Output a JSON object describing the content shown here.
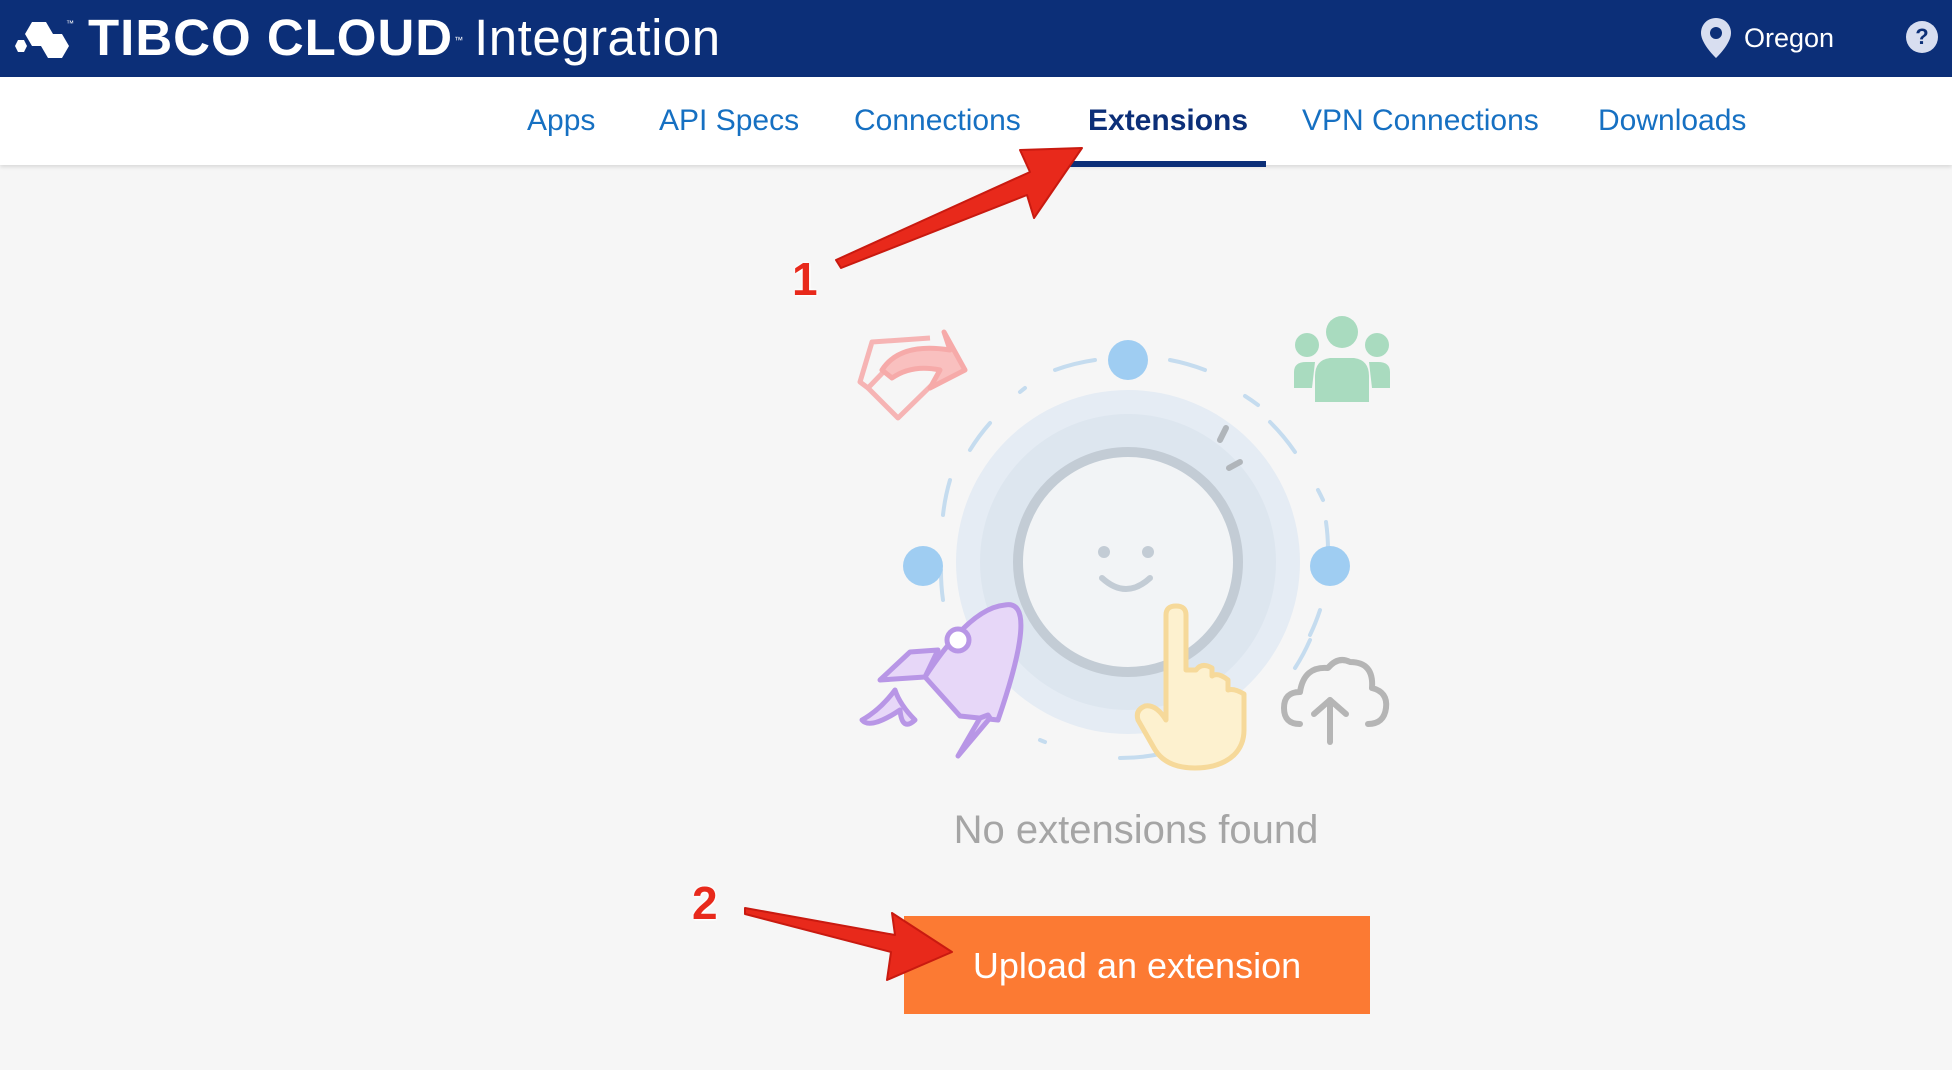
{
  "header": {
    "brand_name": "TIBCO CLOUD",
    "trademark": "™",
    "product": "Integration",
    "region_icon": "location-pin-icon",
    "region": "Oregon",
    "help_icon": "question-circle-icon",
    "help_glyph": "?"
  },
  "nav": {
    "tabs": [
      {
        "label": "Apps"
      },
      {
        "label": "API Specs"
      },
      {
        "label": "Connections"
      },
      {
        "label": "Extensions",
        "active": true
      },
      {
        "label": "VPN Connections"
      },
      {
        "label": "Downloads"
      }
    ]
  },
  "empty_state": {
    "message": "No extensions found",
    "button_label": "Upload an extension",
    "icons": [
      "share-arrow-icon",
      "users-group-icon",
      "rocket-icon",
      "cloud-upload-icon",
      "smiley-face-icon",
      "pointing-hand-icon"
    ]
  },
  "annotations": {
    "step1": "1",
    "step2": "2"
  },
  "colors": {
    "header_bg": "#0c2f78",
    "link": "#1670c2",
    "button": "#fc7a33",
    "annotation": "#e8291b"
  }
}
